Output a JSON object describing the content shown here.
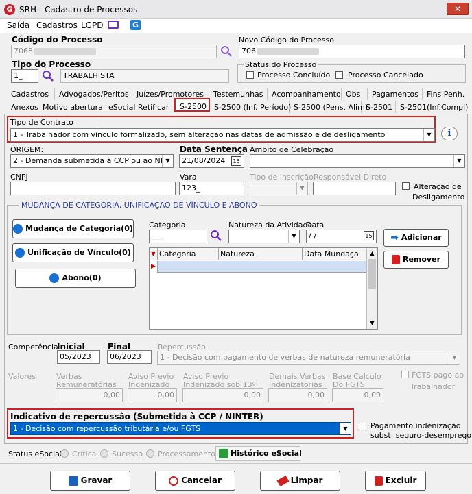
{
  "window": {
    "title": "SRH - Cadastro de Processos",
    "logo_letter": "G",
    "close_glyph": "✕"
  },
  "menu": {
    "items": [
      "Saída",
      "Cadastros",
      "LGPD"
    ]
  },
  "codigo": {
    "label": "Código do Processo",
    "value": "7068"
  },
  "novo_codigo": {
    "label": "Novo Código do Processo",
    "value": "706"
  },
  "tipo_processo": {
    "label": "Tipo do Processo",
    "code": "1_",
    "name": "TRABALHISTA"
  },
  "status_processo": {
    "label": "Status do Processo",
    "concluido": "Processo Concluído",
    "cancelado": "Processo Cancelado"
  },
  "tabs_row1": [
    "Cadastros",
    "Advogados/Peritos",
    "Juízes/Promotores",
    "Testemunhas",
    "Acompanhamento",
    "Obs",
    "Pagamentos",
    "Fins Penh."
  ],
  "tabs_row2": [
    "Anexos",
    "Motivo abertura",
    "eSocial Retificar",
    "S-2500",
    "S-2500 (Inf. Período)",
    "S-2500 (Pens. Alim)",
    "S-2501",
    "S-2501(Inf.Compl)"
  ],
  "tipo_contrato": {
    "label": "Tipo de Contrato",
    "value": "1 - Trabalhador com vínculo formalizado, sem alteração nas datas de admissão e de desligamento",
    "info_glyph": "i"
  },
  "origem": {
    "label": "ORIGEM:",
    "value": "2 - Demanda submetida à CCP ou ao NINTER"
  },
  "data_sentenca": {
    "label": "Data Sentença",
    "value": "21/08/2024",
    "cal": "15"
  },
  "ambito": {
    "label": "Ambito de Celebração",
    "value": ""
  },
  "cnpj": {
    "label": "CNPJ",
    "value": ""
  },
  "vara": {
    "label": "Vara",
    "value": "123_"
  },
  "tipo_inscricao": {
    "label": "Tipo de inscrição"
  },
  "responsavel": {
    "label": "Responsável Direto"
  },
  "alteracao": {
    "label1": "Alteração de",
    "label2": "Desligamento"
  },
  "mudanca": {
    "title": "MUDANÇA DE CATEGORIA, UNIFICAÇÃO DE VÍNCULO E ABONO",
    "btn_mudanca": "Mudança de Categoria(0)",
    "btn_unificacao": "Unificação de Vínculo(0)",
    "btn_abono": "Abono(0)",
    "categoria_label": "Categoria",
    "categoria_value": "___",
    "natureza_label": "Natureza da Atividade",
    "data_label": "Data",
    "data_value": " /  /",
    "cal": "15",
    "grid_headers": [
      "Categoria",
      "Natureza",
      "Data Mundaça"
    ],
    "btn_adicionar": "Adicionar",
    "btn_remover": "Remover"
  },
  "competencia": {
    "label": "Competência",
    "inicial_label": "Inicial",
    "inicial": "05/2023",
    "final_label": "Final",
    "final": "06/2023"
  },
  "repercussao": {
    "label": "Repercussão",
    "value": "1 - Decisão com pagamento de verbas de natureza remuneratória"
  },
  "valores": {
    "label": "Valores",
    "verbas1": "Verbas",
    "verbas2": "Remuneratórias",
    "verbas_val": "0,00",
    "aviso1": "Aviso Previo",
    "aviso2": "Indenizado",
    "aviso_val": "0,00",
    "aviso13_1": "Aviso Previo",
    "aviso13_2": "Indenizado sob 13º",
    "aviso13_val": "0,00",
    "demais1": "Demais Verbas",
    "demais2": "Indenizatorias",
    "demais_val": "0,00",
    "base1": "Base Calculo",
    "base2": "Do FGTS",
    "base_val": "0,00",
    "fgts1": "FGTS pago ao",
    "fgts2": "Trabalhador"
  },
  "indicativo": {
    "label": "Indicativo de repercussão (Submetida à CCP / NINTER)",
    "value": "1 - Decisão com repercussão tributária e/ou FGTS"
  },
  "pagamento": {
    "label1": "Pagamento indenização",
    "label2": "subst. seguro-desemprego?"
  },
  "esocial": {
    "label": "Status eSocial:",
    "critica": "Crítica",
    "sucesso": "Sucesso",
    "processamento": "Processamento",
    "historico": "Histórico eSocial"
  },
  "actions": {
    "gravar": "Gravar",
    "cancelar": "Cancelar",
    "limpar": "Limpar",
    "excluir": "Excluir"
  },
  "colors": {
    "accent": "#0a5fd6",
    "danger": "#d02020",
    "selection": "#0066cc"
  }
}
